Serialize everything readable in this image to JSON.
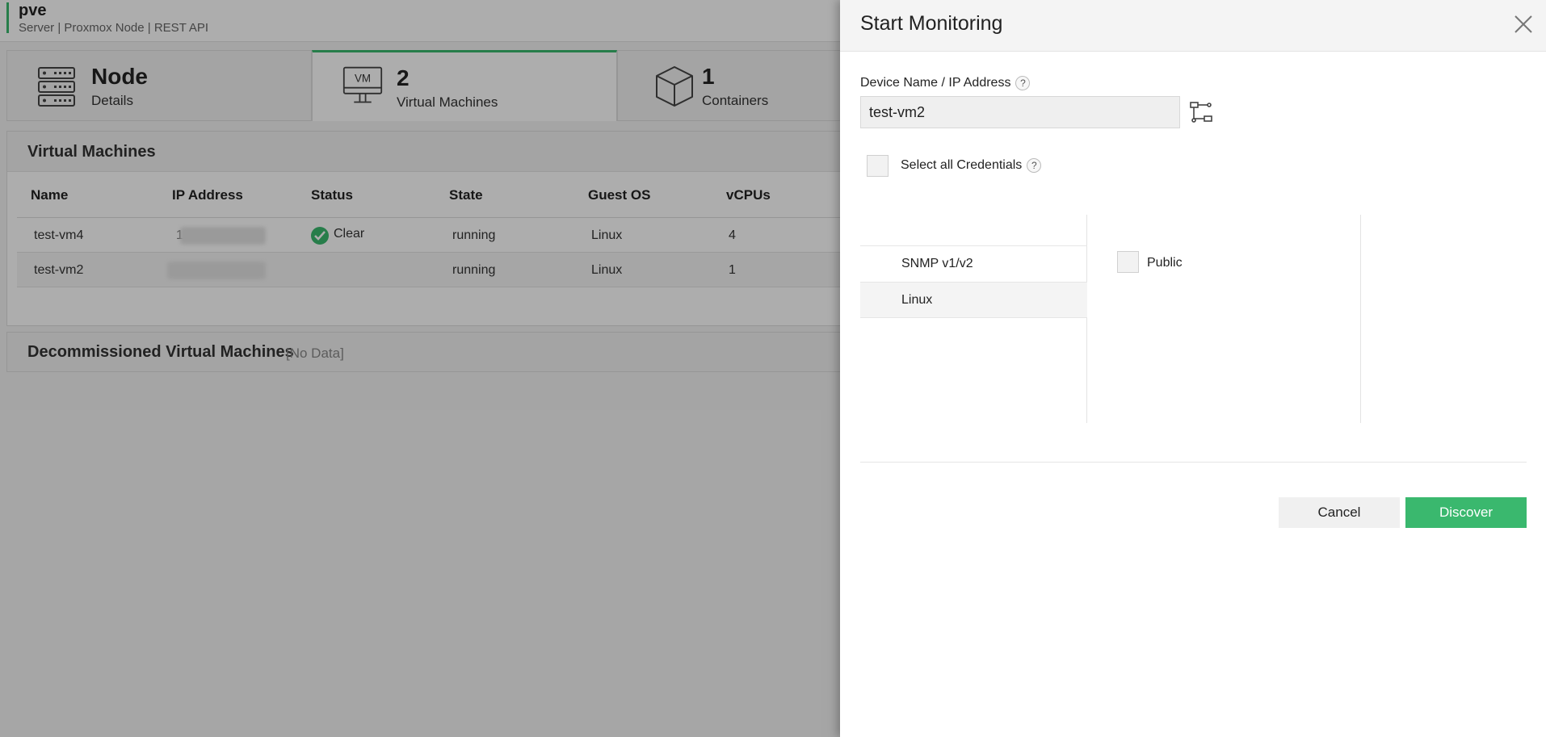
{
  "header": {
    "title": "pve",
    "subtitle": "Server | Proxmox Node  | REST API"
  },
  "tabs": [
    {
      "number": "Node",
      "label": "Details",
      "icon": "server-rack-icon"
    },
    {
      "number": "2",
      "label": "Virtual Machines",
      "icon": "vm-monitor-icon",
      "icon_text": "VM"
    },
    {
      "number": "1",
      "label": "Containers",
      "icon": "cube-icon"
    }
  ],
  "vm_panel": {
    "title": "Virtual Machines",
    "columns": [
      "Name",
      "IP Address",
      "Status",
      "State",
      "Guest OS",
      "vCPUs"
    ],
    "rows": [
      {
        "name": "test-vm4",
        "ip": "1",
        "status": "Clear",
        "state": "running",
        "os": "Linux",
        "vcpus": "4"
      },
      {
        "name": "test-vm2",
        "ip": "",
        "status": "",
        "state": "running",
        "os": "Linux",
        "vcpus": "1"
      }
    ]
  },
  "decommissioned": {
    "title": "Decommissioned Virtual Machines",
    "note": "[No Data]"
  },
  "drawer": {
    "title": "Start Monitoring",
    "device_label": "Device Name / IP Address",
    "help_text": "?",
    "device_value": "test-vm2",
    "select_all_label": "Select all Credentials",
    "credential_types": [
      "SNMP v1/v2",
      "Linux"
    ],
    "credential_names": [
      "Public"
    ],
    "cancel_label": "Cancel",
    "discover_label": "Discover"
  },
  "colors": {
    "accent": "#3ab86e"
  }
}
